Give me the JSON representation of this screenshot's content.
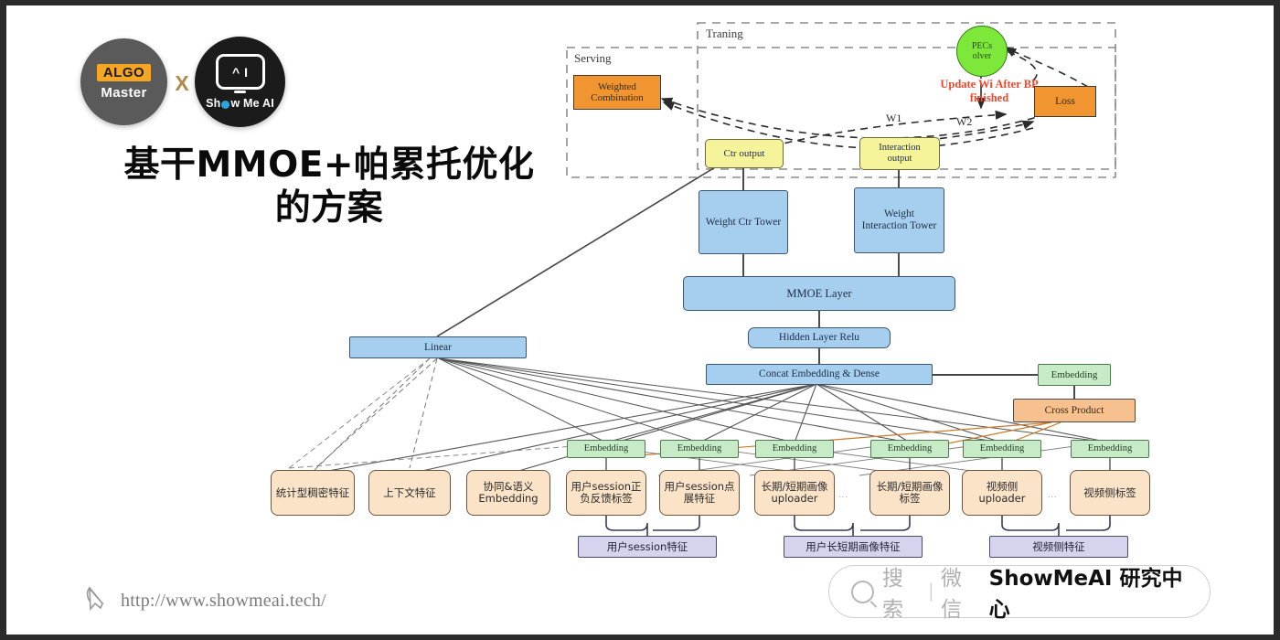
{
  "branding": {
    "algo_badge": "ALGO",
    "algo_master": "Master",
    "cross": "X",
    "showmeai_screen_left": "^",
    "showmeai_screen_right": "I",
    "showmeai_text_a": "Sh",
    "showmeai_text_b": "w Me AI"
  },
  "headline": {
    "line1": "基干MMOE+帕累托优化",
    "line2": "的方案"
  },
  "footer": {
    "url": "http://www.showmeai.tech/",
    "search_placeholder": "搜索",
    "divider": "|",
    "wechat": "微信",
    "brand": "ShowMeAI 研究中心"
  },
  "diagram": {
    "groups": [
      {
        "name": "serving",
        "label": "Serving"
      },
      {
        "name": "training",
        "label": "Traning"
      }
    ],
    "annotations": {
      "update_note": "Update Wi After BP finished",
      "w1": "W1",
      "w2": "W2",
      "ellipsis": "..."
    },
    "nodes": {
      "weighted_combination": "Weighted Combination",
      "pecsolver_line1": "PECs",
      "pecsolver_line2": "olver",
      "loss": "Loss",
      "ctr_output": "Ctr output",
      "interaction_output_l1": "Interaction",
      "interaction_output_l2": "output",
      "weight_ctr_tower": "Weight Ctr Tower",
      "weight_interaction_tower": "Weight Interaction Tower",
      "mmoe_layer": "MMOE Layer",
      "hidden_layer_relu": "Hidden Layer Relu",
      "concat_embedding_dense": "Concat Embedding & Dense",
      "linear": "Linear",
      "cross_product": "Cross Product",
      "embedding": "Embedding"
    },
    "embedding_row": [
      "Embedding",
      "Embedding",
      "Embedding",
      "Embedding",
      "Embedding",
      "Embedding"
    ],
    "features": [
      "统计型稠密特征",
      "上下文特征",
      "协同&语义Embedding",
      "用户session正负反馈标签",
      "用户session点展特征",
      "长期/短期画像uploader",
      "长期/短期画像标签",
      "视频侧uploader",
      "视频侧标签"
    ],
    "feature_groups": [
      "用户session特征",
      "用户长短期画像特征",
      "视频侧特征"
    ]
  }
}
